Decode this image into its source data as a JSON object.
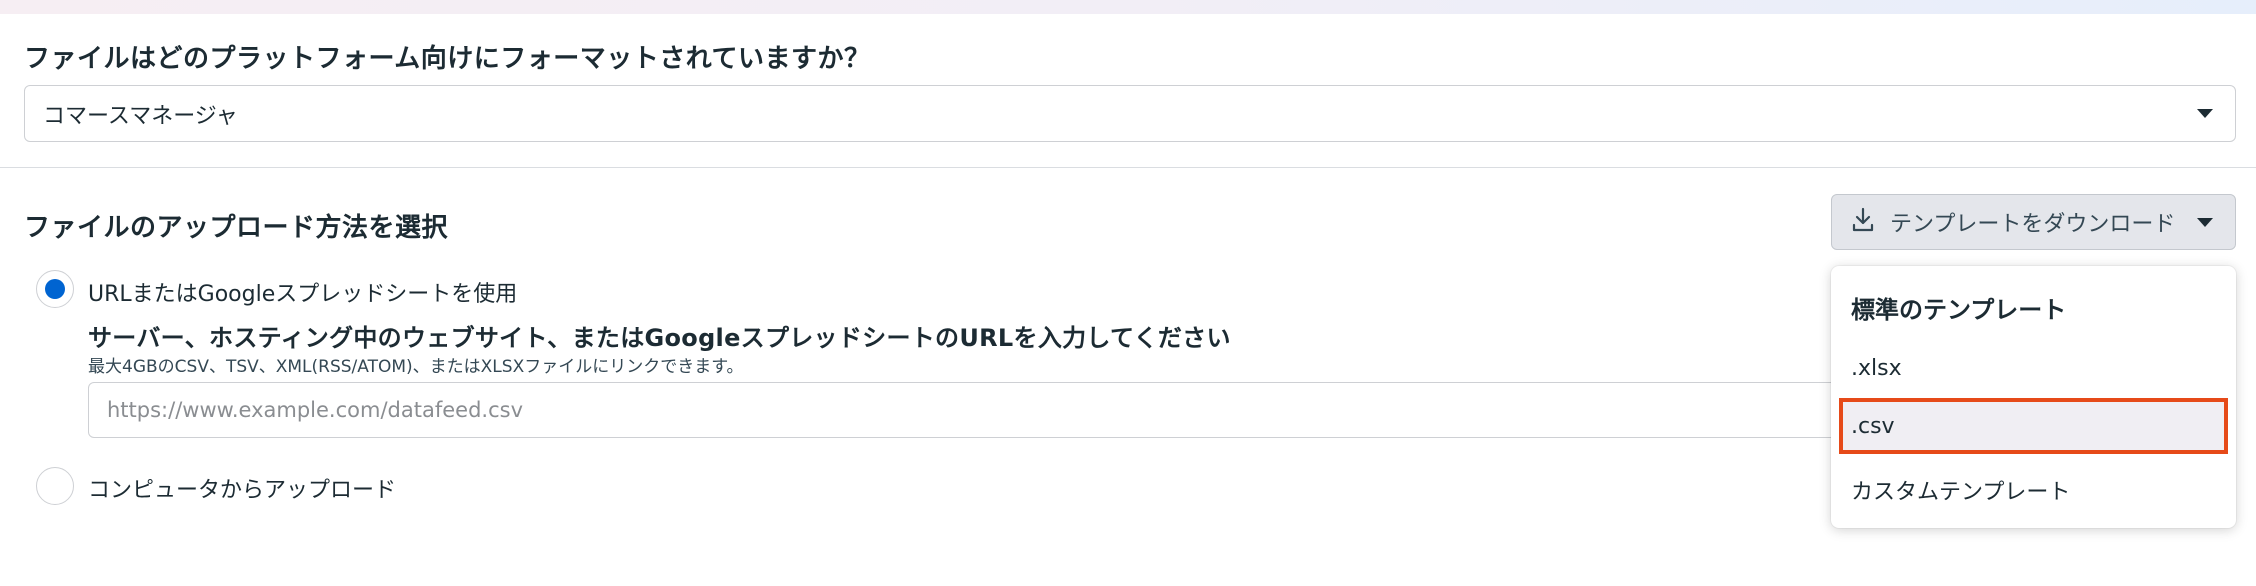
{
  "platform_question": {
    "title": "ファイルはどのプラットフォーム向けにフォーマットされていますか？",
    "selected_value": "コマースマネージャ"
  },
  "upload_method": {
    "title": "ファイルのアップロード方法を選択",
    "download_template_label": "テンプレートをダウンロード",
    "options": [
      {
        "label": "URLまたはGoogleスプレッドシートを使用",
        "checked": true
      },
      {
        "label": "コンピュータからアップロード",
        "checked": false
      }
    ],
    "url_section": {
      "heading": "サーバー、ホスティング中のウェブサイト、またはGoogleスプレッドシートのURLを入力してください",
      "subtext": "最大4GBのCSV、TSV、XML(RSS/ATOM)、またはXLSXファイルにリンクできます。",
      "placeholder": "https://www.example.com/datafeed.csv",
      "value": ""
    }
  },
  "template_dropdown": {
    "header": "標準のテンプレート",
    "items": [
      ".xlsx",
      ".csv",
      "カスタムテンプレート"
    ],
    "highlighted_item": ".csv"
  },
  "colors": {
    "accent": "#0064d1",
    "highlight_border": "#e64a19",
    "button_bg": "#e4e6eb"
  },
  "icons": {
    "download_button": "download-icon",
    "select_caret": "caret-down-icon"
  }
}
